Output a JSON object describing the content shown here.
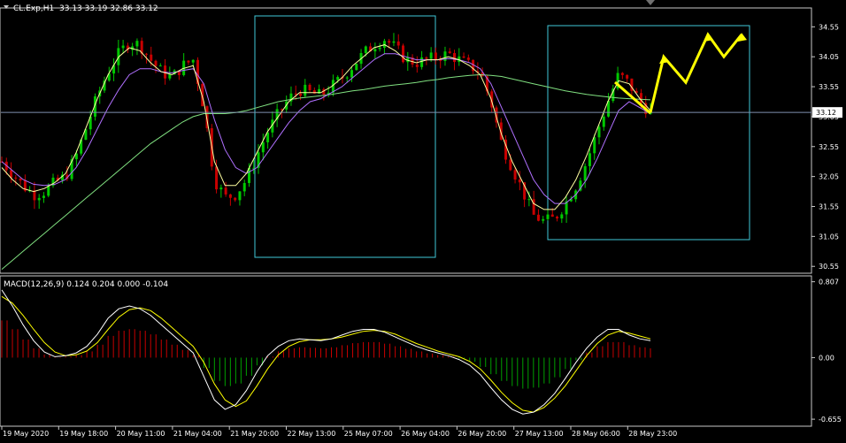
{
  "header": {
    "symbol_label": "CL.Exp,H1",
    "ohlc_label": "33.13 33.19 32.86 33.12"
  },
  "macd_header": {
    "label": "MACD(12,26,9) 0.124 0.204 0.000 -0.104"
  },
  "colors": {
    "background": "#000000",
    "frame": "#c8c8c8",
    "bull_candle": "#00c800",
    "bear_candle": "#c80000",
    "ma_fast": "#ffffa0",
    "ma_mid": "#b070ff",
    "ma_slow": "#80e080",
    "bid_line": "#8090b0",
    "box": "#40c8d8",
    "forecast_arrow": "#ffff00",
    "macd_line": "#ffffff",
    "signal_line": "#ffff00",
    "hist_pos": "#c80000",
    "hist_neg": "#00a000"
  },
  "chart_data": [
    {
      "type": "candlestick",
      "symbol": "CL.Exp",
      "timeframe": "H1",
      "y_ticks": [
        "34.55",
        "34.05",
        "33.55",
        "33.05",
        "32.55",
        "32.05",
        "31.55",
        "31.05",
        "30.55"
      ],
      "ylim": [
        30.45,
        34.85
      ],
      "current_price_label": "33.12",
      "current_price": 33.12,
      "x_tick_labels": [
        "19 May 2020",
        "19 May 18:00",
        "20 May 11:00",
        "21 May 04:00",
        "21 May 20:00",
        "22 May 13:00",
        "25 May 07:00",
        "26 May 04:00",
        "26 May 20:00",
        "27 May 13:00",
        "28 May 06:00",
        "28 May 23:00"
      ],
      "price_path": [
        32.3,
        32.1,
        31.9,
        31.75,
        31.8,
        31.95,
        32.05,
        32.4,
        32.9,
        33.4,
        33.8,
        34.1,
        34.3,
        34.25,
        34.0,
        33.8,
        33.7,
        33.9,
        34.0,
        33.2,
        32.0,
        31.7,
        31.75,
        32.0,
        32.4,
        32.8,
        33.1,
        33.35,
        33.5,
        33.45,
        33.4,
        33.55,
        33.7,
        33.9,
        34.1,
        34.25,
        34.35,
        34.2,
        34.0,
        33.95,
        34.0,
        34.05,
        34.1,
        34.0,
        33.9,
        33.8,
        33.3,
        32.6,
        32.2,
        31.8,
        31.4,
        31.3,
        31.35,
        31.6,
        31.9,
        32.3,
        32.8,
        33.3,
        33.75,
        33.6,
        33.3,
        33.12
      ],
      "ma_fast": [
        32.2,
        32.0,
        31.85,
        31.8,
        31.85,
        31.95,
        32.1,
        32.45,
        32.9,
        33.35,
        33.75,
        34.05,
        34.2,
        34.15,
        33.95,
        33.8,
        33.75,
        33.85,
        33.9,
        33.3,
        32.3,
        31.9,
        31.9,
        32.1,
        32.45,
        32.8,
        33.05,
        33.3,
        33.45,
        33.45,
        33.45,
        33.55,
        33.7,
        33.9,
        34.05,
        34.2,
        34.25,
        34.15,
        34.0,
        33.95,
        34.0,
        34.0,
        34.05,
        34.0,
        33.9,
        33.75,
        33.35,
        32.75,
        32.3,
        31.95,
        31.6,
        31.5,
        31.5,
        31.7,
        32.0,
        32.4,
        32.85,
        33.3,
        33.65,
        33.6,
        33.35,
        33.15
      ],
      "ma_mid": [
        32.3,
        32.15,
        32.0,
        31.92,
        31.9,
        31.92,
        32.0,
        32.2,
        32.5,
        32.85,
        33.2,
        33.5,
        33.75,
        33.85,
        33.85,
        33.8,
        33.78,
        33.82,
        33.85,
        33.6,
        33.0,
        32.5,
        32.2,
        32.1,
        32.2,
        32.45,
        32.7,
        32.95,
        33.15,
        33.3,
        33.35,
        33.45,
        33.55,
        33.7,
        33.85,
        34.0,
        34.1,
        34.1,
        34.05,
        34.0,
        34.0,
        34.0,
        34.02,
        34.0,
        33.95,
        33.85,
        33.6,
        33.2,
        32.8,
        32.4,
        32.0,
        31.75,
        31.6,
        31.6,
        31.75,
        32.0,
        32.35,
        32.75,
        33.15,
        33.3,
        33.2,
        33.1
      ],
      "ma_slow": [
        30.5,
        30.65,
        30.8,
        30.95,
        31.1,
        31.25,
        31.4,
        31.55,
        31.7,
        31.85,
        32.0,
        32.15,
        32.3,
        32.45,
        32.6,
        32.72,
        32.84,
        32.96,
        33.05,
        33.1,
        33.1,
        33.1,
        33.12,
        33.15,
        33.2,
        33.25,
        33.3,
        33.33,
        33.36,
        33.38,
        33.4,
        33.42,
        33.45,
        33.48,
        33.5,
        33.53,
        33.56,
        33.58,
        33.6,
        33.62,
        33.65,
        33.67,
        33.7,
        33.72,
        33.74,
        33.75,
        33.74,
        33.72,
        33.68,
        33.64,
        33.6,
        33.56,
        33.52,
        33.48,
        33.45,
        33.42,
        33.4,
        33.38,
        33.36,
        33.35,
        33.34,
        33.33
      ],
      "forecast_path": [
        33.12,
        34.05,
        33.62,
        34.42,
        34.05,
        34.42
      ]
    },
    {
      "type": "macd",
      "params": "12,26,9",
      "values_label": "0.124 0.204 0.000 -0.104",
      "y_ticks": [
        "0.807",
        "0.00",
        "-0.655"
      ],
      "ylim": [
        -0.72,
        0.86
      ],
      "macd": [
        0.72,
        0.55,
        0.35,
        0.18,
        0.06,
        0.01,
        0.02,
        0.05,
        0.12,
        0.25,
        0.42,
        0.52,
        0.55,
        0.52,
        0.45,
        0.35,
        0.25,
        0.15,
        0.05,
        -0.2,
        -0.45,
        -0.55,
        -0.5,
        -0.35,
        -0.15,
        0.02,
        0.12,
        0.18,
        0.2,
        0.19,
        0.18,
        0.2,
        0.24,
        0.28,
        0.3,
        0.3,
        0.27,
        0.22,
        0.17,
        0.12,
        0.08,
        0.05,
        0.02,
        -0.02,
        -0.08,
        -0.18,
        -0.32,
        -0.45,
        -0.55,
        -0.6,
        -0.58,
        -0.5,
        -0.38,
        -0.22,
        -0.05,
        0.1,
        0.22,
        0.3,
        0.3,
        0.24,
        0.2,
        0.18
      ],
      "signal": [
        0.65,
        0.58,
        0.45,
        0.3,
        0.16,
        0.06,
        0.02,
        0.03,
        0.07,
        0.16,
        0.3,
        0.43,
        0.51,
        0.53,
        0.5,
        0.42,
        0.32,
        0.22,
        0.12,
        -0.05,
        -0.28,
        -0.45,
        -0.52,
        -0.46,
        -0.3,
        -0.12,
        0.03,
        0.12,
        0.17,
        0.19,
        0.19,
        0.2,
        0.22,
        0.25,
        0.28,
        0.29,
        0.28,
        0.25,
        0.2,
        0.15,
        0.11,
        0.07,
        0.04,
        0.01,
        -0.04,
        -0.12,
        -0.24,
        -0.37,
        -0.48,
        -0.56,
        -0.58,
        -0.53,
        -0.43,
        -0.3,
        -0.14,
        0.02,
        0.15,
        0.24,
        0.28,
        0.26,
        0.23,
        0.2
      ]
    }
  ]
}
